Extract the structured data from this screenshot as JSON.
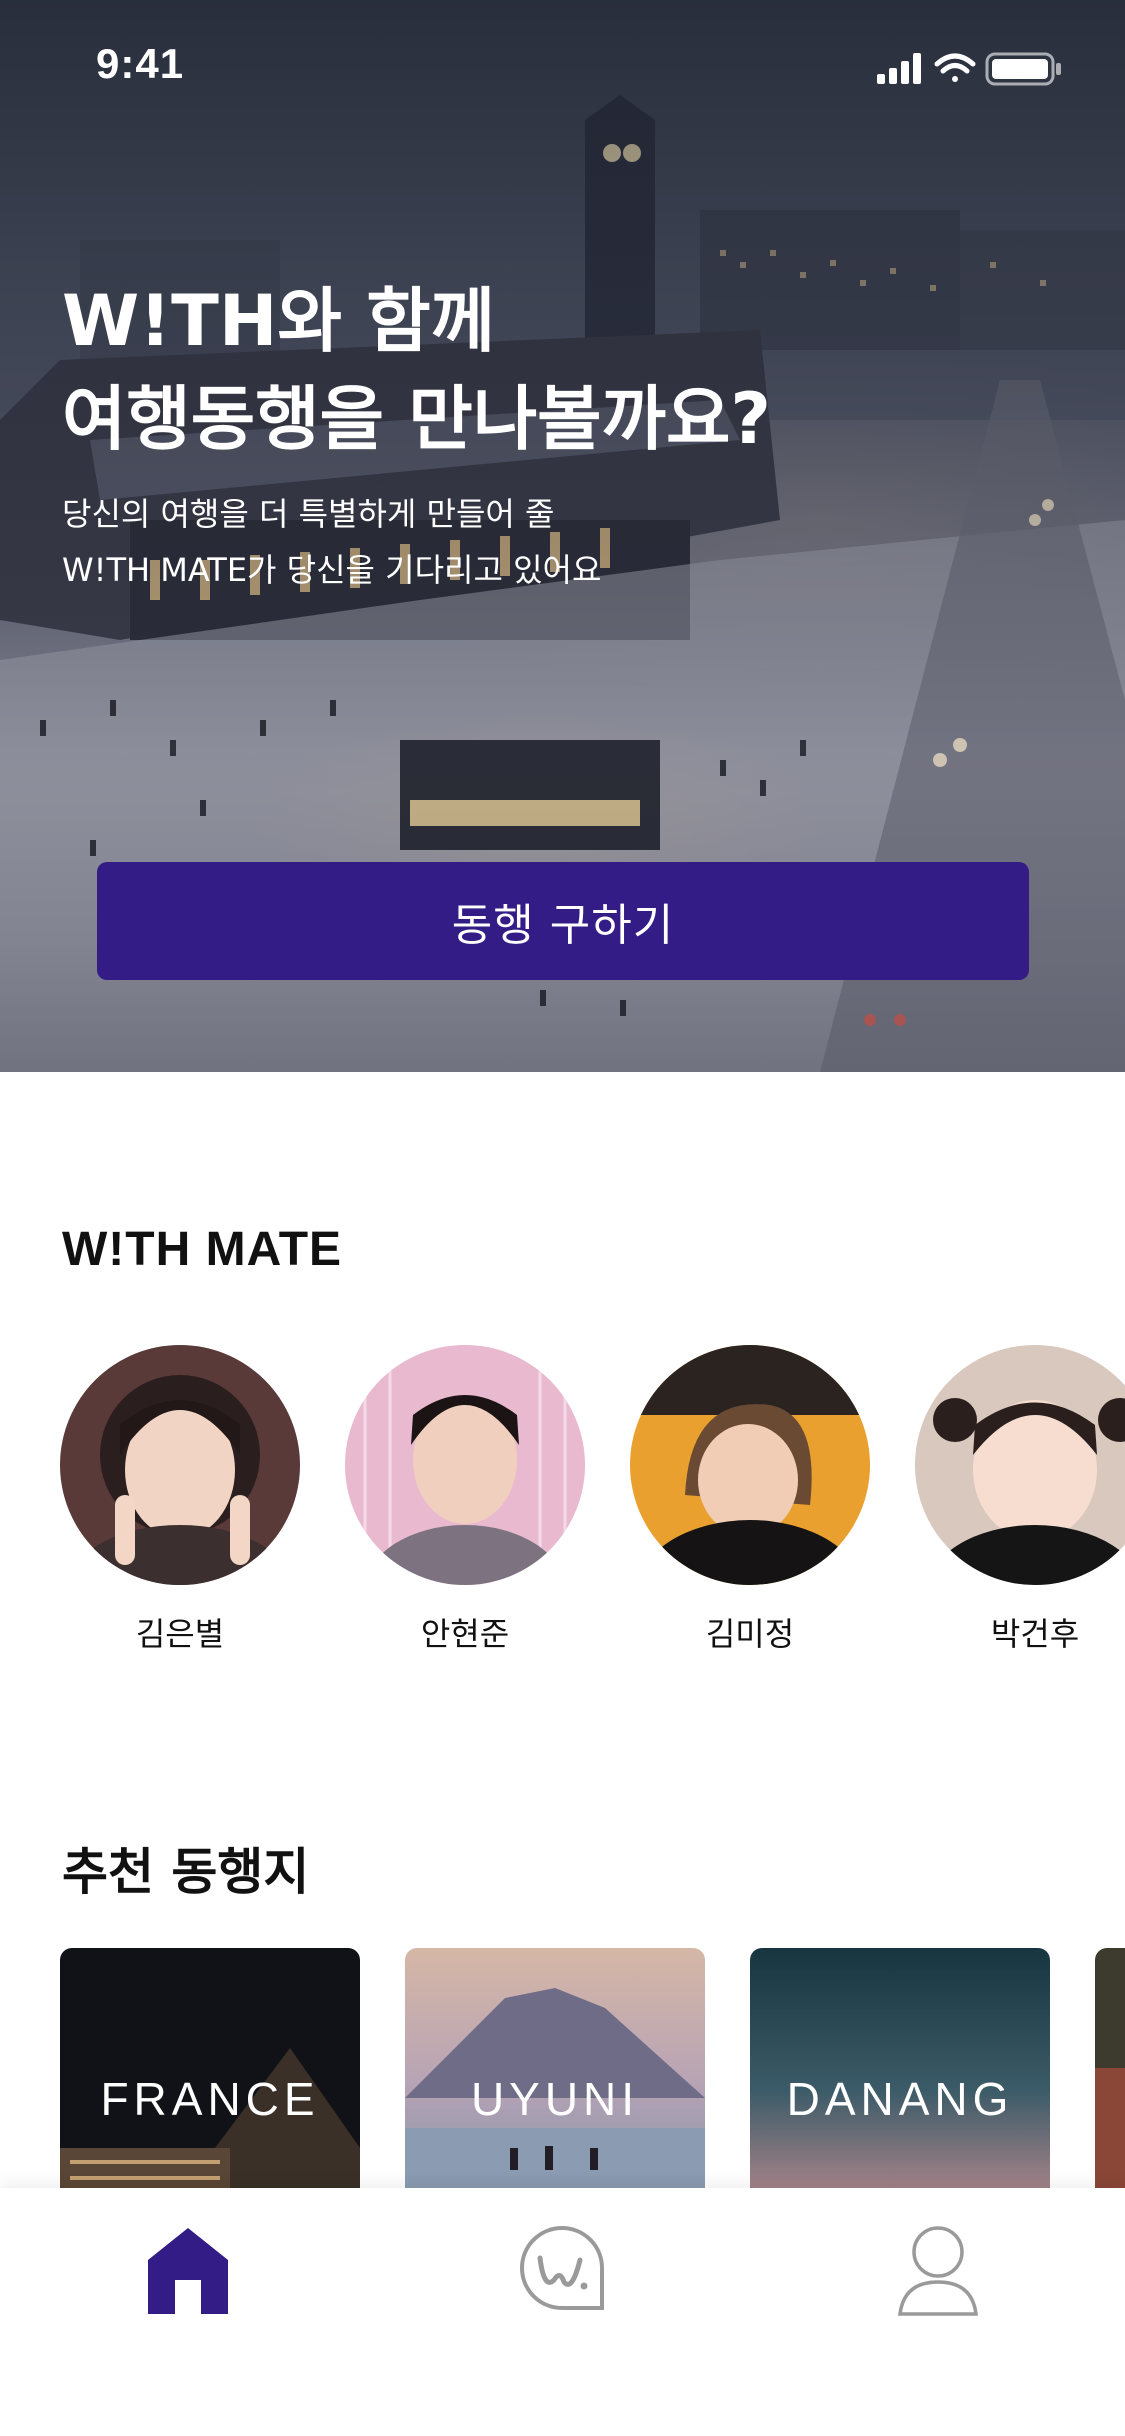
{
  "status_bar": {
    "time": "9:41"
  },
  "hero": {
    "title": "W!TH와 함께\n여행동행을 만나볼까요?",
    "subtitle": "당신의 여행을 더 특별하게 만들어 줄\nW!TH MATE가 당신을 기다리고 있어요",
    "cta_label": "동행 구하기"
  },
  "mates_section": {
    "title": "W!TH MATE",
    "mates": [
      {
        "name": "김은별"
      },
      {
        "name": "안현준"
      },
      {
        "name": "김미정"
      },
      {
        "name": "박건후"
      }
    ]
  },
  "destinations_section": {
    "title": "추천 동행지",
    "cards": [
      {
        "label": "FRANCE"
      },
      {
        "label": "UYUNI"
      },
      {
        "label": "DANANG"
      }
    ]
  },
  "tabbar": {
    "tabs": [
      {
        "icon": "home-icon",
        "active": true
      },
      {
        "icon": "with-logo-icon",
        "active": false
      },
      {
        "icon": "profile-icon",
        "active": false
      }
    ]
  },
  "colors": {
    "accent": "#331c86",
    "inactive_icon": "#9a9a9a"
  }
}
